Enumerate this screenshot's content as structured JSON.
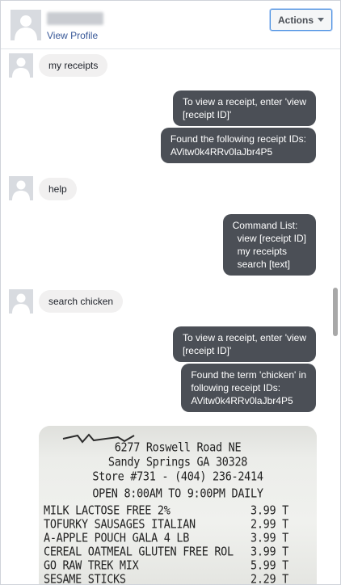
{
  "header": {
    "view_profile": "View Profile",
    "actions_label": "Actions"
  },
  "messages": [
    {
      "from": "user",
      "text": "my receipts"
    },
    {
      "from": "bot",
      "lines": [
        "To view a receipt, enter 'view",
        "[receipt ID]'"
      ]
    },
    {
      "from": "bot",
      "lines": [
        "Found the following receipt IDs:",
        "AVitw0k4RRv0laJbr4P5"
      ]
    },
    {
      "from": "user",
      "text": "help"
    },
    {
      "from": "bot",
      "lines": [
        "Command List:",
        "view [receipt ID]",
        "my receipts",
        "search [text]"
      ]
    },
    {
      "from": "user",
      "text": "search chicken"
    },
    {
      "from": "bot",
      "lines": [
        "To view a receipt, enter 'view",
        "[receipt ID]'"
      ]
    },
    {
      "from": "bot",
      "lines": [
        "Found the term 'chicken' in",
        "following receipt IDs:",
        "AVitw0k4RRv0laJbr4P5"
      ]
    }
  ],
  "receipt": {
    "address": "6277 Roswell Road NE",
    "city": "Sandy Springs  GA  30328",
    "store": "Store #731 - (404) 236-2414",
    "hours": "OPEN 8:00AM TO 9:00PM DAILY",
    "items": [
      {
        "name": "MILK LACTOSE FREE 2%",
        "price": "3.99 T"
      },
      {
        "name": "TOFURKY SAUSAGES ITALIAN",
        "price": "2.99 T"
      },
      {
        "name": "A-APPLE POUCH GALA 4 LB",
        "price": "3.99 T"
      },
      {
        "name": "CEREAL OATMEAL GLUTEN FREE ROL",
        "price": "3.99 T"
      },
      {
        "name": "GO RAW TREK MIX",
        "price": "5.99 T"
      },
      {
        "name": "SESAME STICKS",
        "price": "2.29 T"
      }
    ]
  },
  "colors": {
    "bot_bubble": "#4b4f56",
    "user_bubble": "#f1f0f0",
    "link": "#385898",
    "actions_border": "#4a90e2"
  }
}
